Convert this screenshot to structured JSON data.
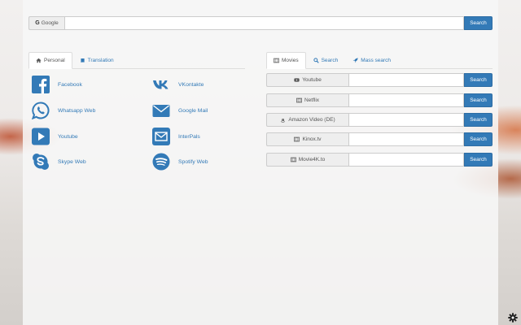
{
  "search": {
    "engine_label": "Google",
    "engine_icon": "google-g-icon",
    "engine_glyph": "G",
    "value": "",
    "placeholder": "",
    "button_label": "Search"
  },
  "left_tabs": [
    {
      "label": "Personal",
      "icon": "home-icon",
      "active": true
    },
    {
      "label": "Translation",
      "icon": "book-icon",
      "active": false
    }
  ],
  "right_tabs": [
    {
      "label": "Movies",
      "icon": "film-icon",
      "active": true
    },
    {
      "label": "Search",
      "icon": "search-icon",
      "active": false
    },
    {
      "label": "Mass search",
      "icon": "rocket-icon",
      "active": false
    }
  ],
  "links": [
    {
      "label": "Facebook",
      "icon": "facebook-icon"
    },
    {
      "label": "VKontakte",
      "icon": "vk-icon"
    },
    {
      "label": "Whatsapp Web",
      "icon": "whatsapp-icon"
    },
    {
      "label": "Google Mail",
      "icon": "mail-icon"
    },
    {
      "label": "Youtube",
      "icon": "youtube-play-icon"
    },
    {
      "label": "InterPals",
      "icon": "envelope-square-icon"
    },
    {
      "label": "Skype Web",
      "icon": "skype-icon"
    },
    {
      "label": "Spotify Web",
      "icon": "spotify-icon"
    }
  ],
  "movies": [
    {
      "label": "Youtube",
      "icon": "youtube-icon",
      "button_label": "Search",
      "value": ""
    },
    {
      "label": "Netflix",
      "icon": "film-icon",
      "button_label": "Search",
      "value": ""
    },
    {
      "label": "Amazon Video (DE)",
      "icon": "amazon-icon",
      "button_label": "Search",
      "value": ""
    },
    {
      "label": "Kinox.tv",
      "icon": "film-icon",
      "button_label": "Search",
      "value": ""
    },
    {
      "label": "Movie4K.to",
      "icon": "film-icon",
      "button_label": "Search",
      "value": ""
    }
  ],
  "settings_icon": "gear-icon",
  "colors": {
    "accent": "#337ab7",
    "panel": "#f7f7f7"
  }
}
